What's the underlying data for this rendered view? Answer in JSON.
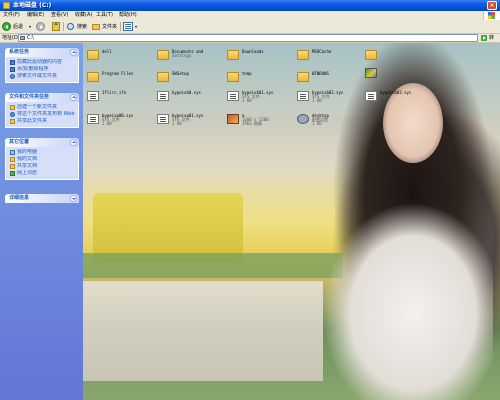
{
  "window": {
    "title": "本地磁盘 (C:)",
    "close_glyph": "×"
  },
  "menu": {
    "items": [
      "文件(F)",
      "编辑(E)",
      "查看(V)",
      "收藏(A)",
      "工具(T)",
      "帮助(H)"
    ]
  },
  "toolbar": {
    "back_label": "后退",
    "caret": "▾",
    "search_label": "搜索",
    "folders_label": "文件夹"
  },
  "address": {
    "label": "地址(D)",
    "value": "C:\\",
    "go_label": "转到"
  },
  "taskpane": {
    "system_tasks": {
      "header": "系统任务",
      "links": [
        "隐藏此驱动器的内容",
        "添加/删除程序",
        "搜索文件或文件夹"
      ]
    },
    "file_tasks": {
      "header": "文件和文件夹任务",
      "links": [
        "创建一个新文件夹",
        "将这个文件夹发布到 Web",
        "共享此文件夹"
      ]
    },
    "other_places": {
      "header": "其它位置",
      "links": [
        "我的电脑",
        "我的文档",
        "共享文档",
        "网上邻居"
      ]
    },
    "details": {
      "header": "详细信息"
    }
  },
  "files": [
    {
      "name": "dell",
      "meta": "",
      "meta2": "",
      "icon": "folder"
    },
    {
      "name": "Documents and",
      "meta": "Settings",
      "meta2": "",
      "icon": "folder"
    },
    {
      "name": "Downloads",
      "meta": "",
      "meta2": "",
      "icon": "folder"
    },
    {
      "name": "MSOCache",
      "meta": "",
      "meta2": "",
      "icon": "folder"
    },
    {
      "name": "",
      "meta": "",
      "meta2": "",
      "icon": "folder"
    },
    {
      "name": "Program Files",
      "meta": "",
      "meta2": "",
      "icon": "folder"
    },
    {
      "name": "SWSetup",
      "meta": "",
      "meta2": "",
      "icon": "folder"
    },
    {
      "name": "temp",
      "meta": "",
      "meta2": "",
      "icon": "folder"
    },
    {
      "name": "WINDOWS",
      "meta": "",
      "meta2": "",
      "icon": "folder"
    },
    {
      "name": "",
      "meta": "",
      "meta2": "",
      "icon": "app"
    },
    {
      "name": "1flirc.ifo",
      "meta": "",
      "meta2": "",
      "icon": "doc"
    },
    {
      "name": "bypeixb0.sys",
      "meta": "",
      "meta2": "",
      "icon": "doc"
    },
    {
      "name": "bypeixb01.sys",
      "meta": "SYS 文件",
      "meta2": "1 KB",
      "icon": "doc"
    },
    {
      "name": "bypeixb02.sys",
      "meta": "SYS 文件",
      "meta2": "1 KB",
      "icon": "doc"
    },
    {
      "name": "bypeixb03.sys",
      "meta": "",
      "meta2": "",
      "icon": "doc"
    },
    {
      "name": "bypeixp00.sys",
      "meta": "SYS 文件",
      "meta2": "1 KB",
      "icon": "doc"
    },
    {
      "name": "bypeixp01.sys",
      "meta": "SYS 文件",
      "meta2": "1 KB",
      "icon": "doc"
    },
    {
      "name": "a",
      "meta": "1600 x 1200",
      "meta2": "JPEG 图像",
      "icon": "img"
    },
    {
      "name": "desktop",
      "meta": "配置设置",
      "meta2": "1 KB",
      "icon": "gear"
    }
  ]
}
